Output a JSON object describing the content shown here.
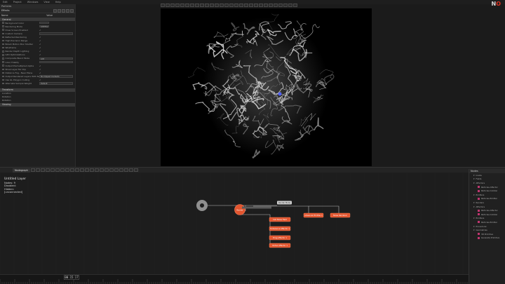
{
  "menubar": {
    "items": [
      "Edit",
      "Project",
      "Windows",
      "View",
      "Help"
    ]
  },
  "logo": {
    "text_a": "N",
    "text_b": "O"
  },
  "properties": {
    "header": "Particles",
    "tab": "Effects",
    "sub_left": "Name",
    "sub_right": "Value",
    "section_general": "General",
    "rows": [
      {
        "label": "Background Color",
        "kind": "field"
      },
      {
        "label": "Rendering Mode",
        "kind": "field",
        "value": "Additive"
      },
      {
        "label": "Draw Screen Enabled",
        "kind": "check"
      },
      {
        "label": "Custom Camera",
        "kind": "field wide"
      },
      {
        "label": "Reflected Rendering",
        "kind": "check"
      },
      {
        "label": "High Precision Range",
        "kind": "check"
      },
      {
        "label": "Bokeh Motion Blur Shutter",
        "kind": "check"
      },
      {
        "label": "Wireframe",
        "kind": "check"
      },
      {
        "label": "Render Depth Lighting",
        "kind": "check"
      },
      {
        "label": "GPU Optimizations",
        "kind": "check"
      },
      {
        "label": "Composite Blend Mode",
        "kind": "field wide",
        "value": "Add"
      },
      {
        "label": "Color Fidelity",
        "kind": "field wide"
      },
      {
        "label": "Output Premultiplied Alpha",
        "kind": "check"
      },
      {
        "label": "Show Layer Far Clip",
        "kind": "check"
      },
      {
        "label": "Distance Fog - Near Plane",
        "kind": "check"
      },
      {
        "label": "Output Rendered Layers With No Clip",
        "kind": "field wide",
        "value": "No Clipped Contents"
      },
      {
        "label": "Use GL Polygon Culling",
        "kind": "check"
      },
      {
        "label": "Alternate Sample Weight",
        "kind": "field wide",
        "value": "Default"
      }
    ],
    "section_transform": "Transform",
    "rows2": [
      {
        "label": "Location"
      },
      {
        "label": "Rotation"
      },
      {
        "label": "Rotation"
      }
    ],
    "section_viewing": "Viewing"
  },
  "graph_tab": {
    "label": "Nodegraph"
  },
  "layer_info": {
    "lines": [
      "Untitled Layer",
      "Nodes: 9",
      "Disabled:",
      "Hidden:",
      "[unconnected]"
    ]
  },
  "nodes": {
    "layer_root": "Render",
    "node_top": "Render Mode",
    "children_right": [
      "Advanced Emitter 1",
      "Noise Renderer"
    ],
    "children_column": [
      "Cell Noise Field",
      "Turbulence Affector 1",
      "Drag Affector 1",
      "Vortex Affector 1"
    ]
  },
  "right_dock": {
    "header": "Nodes",
    "items": [
      {
        "text": "Inside",
        "kind": "plain"
      },
      {
        "text": "Fields",
        "kind": "plain"
      },
      {
        "text": "Affectors",
        "kind": "plain"
      },
      {
        "text": "Particles Affector",
        "kind": "sq"
      },
      {
        "text": "Particles Collider",
        "kind": "sq"
      },
      {
        "text": "Emitters",
        "kind": "plain"
      },
      {
        "text": "Particles Emitter",
        "kind": "sq"
      },
      {
        "text": "Renders",
        "kind": "plain"
      },
      {
        "text": "Affectors",
        "kind": "plain"
      },
      {
        "text": "Particles Affector",
        "kind": "sq"
      },
      {
        "text": "Particles Collider",
        "kind": "sq"
      },
      {
        "text": "Emitters",
        "kind": "plain"
      },
      {
        "text": "Particles Emitter",
        "kind": "sq"
      },
      {
        "text": "Procedural",
        "kind": "plain"
      },
      {
        "text": "Geometries",
        "kind": "plain"
      },
      {
        "text": "3D Primitive",
        "kind": "sq"
      },
      {
        "text": "Generate Primitive",
        "kind": "sq"
      }
    ]
  },
  "timecode": {
    "value": "00:15:17"
  },
  "colors": {
    "accent": "#e0301e",
    "node": "#e3552f",
    "node_text": "#ffffff"
  }
}
